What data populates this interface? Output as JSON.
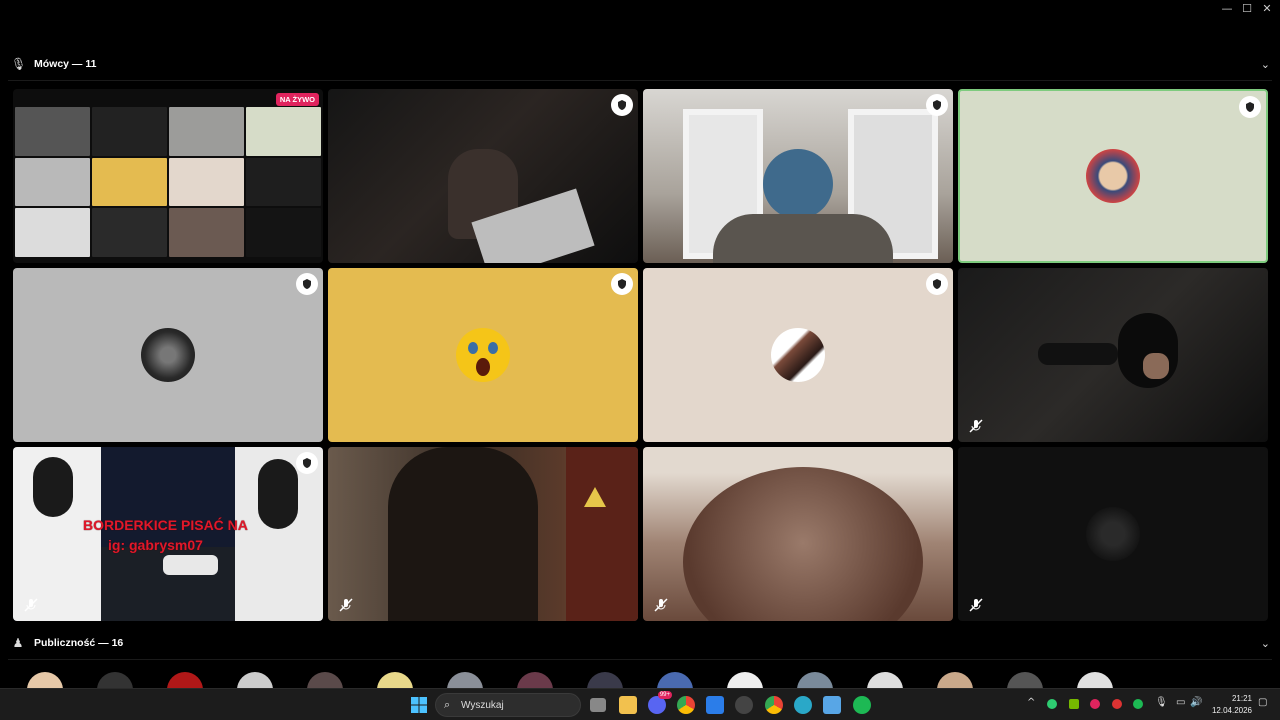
{
  "window": {
    "minimize": "—",
    "maximize": "☐",
    "close": "✕"
  },
  "speakers": {
    "title": "Mówcy — 11",
    "chevron": "⌄"
  },
  "live_badge": "NA ŻYWO",
  "overlay": {
    "line1": "BORDERKICE PISAĆ NA",
    "line2": "ig: gabrysm07"
  },
  "audience": {
    "title": "Publiczność — 16",
    "chevron": "⌄"
  },
  "taskbar": {
    "search_placeholder": "Wyszukaj",
    "notif_count": "99+",
    "time": "21:21",
    "date": "12.04.2026"
  },
  "colors": {
    "background": "#000000",
    "speaking_border": "#7ecb7e",
    "live": "#e0245e"
  }
}
